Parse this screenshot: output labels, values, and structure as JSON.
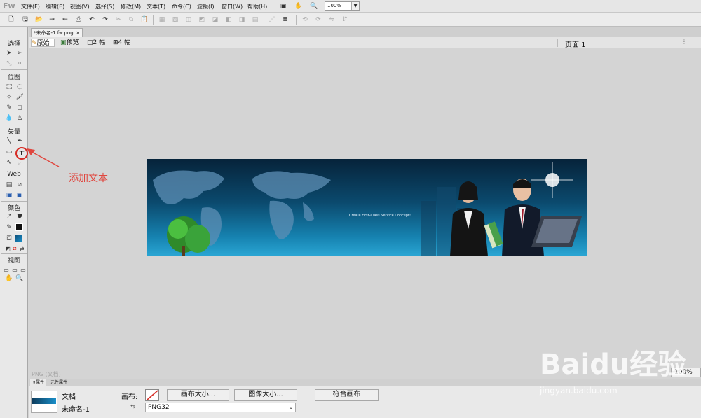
{
  "app": {
    "logo": "Fw"
  },
  "menu": [
    {
      "label": "文件(F)"
    },
    {
      "label": "编辑(E)"
    },
    {
      "label": "视图(V)"
    },
    {
      "label": "选择(S)"
    },
    {
      "label": "修改(M)"
    },
    {
      "label": "文本(T)"
    },
    {
      "label": "命令(C)"
    },
    {
      "label": "滤镜(I)"
    },
    {
      "label": "窗口(W)"
    },
    {
      "label": "帮助(H)"
    }
  ],
  "zoom_menu": "100%",
  "document_tab": "*未命名-1.fw.png",
  "view_tabs": {
    "original": "原始",
    "preview": "预览",
    "two_up": "2 幅",
    "four_up": "4 幅"
  },
  "page_selector": "页面 1",
  "tools": {
    "select_label": "选择",
    "bitmap_label": "位图",
    "vector_label": "矢量",
    "web_label": "Web",
    "colors_label": "颜色",
    "view_label": "视图"
  },
  "annotation": {
    "text": "添加文本",
    "color": "#e0463e"
  },
  "banner": {
    "tagline": "Create First-Class Service Concept!"
  },
  "status": {
    "text": "PNG (文档)",
    "zoom": "100%"
  },
  "properties": {
    "tabs": [
      "属性",
      "元件属性"
    ],
    "doc_type": "文档",
    "doc_name": "未命名-1",
    "canvas_label": "画布:",
    "canvas_size_button": "画布大小...",
    "image_size_button": "图像大小...",
    "fit_canvas_button": "符合画布",
    "format_value": "PNG32"
  },
  "watermark": {
    "logo": "Baidu经验",
    "url": "jingyan.baidu.com"
  }
}
